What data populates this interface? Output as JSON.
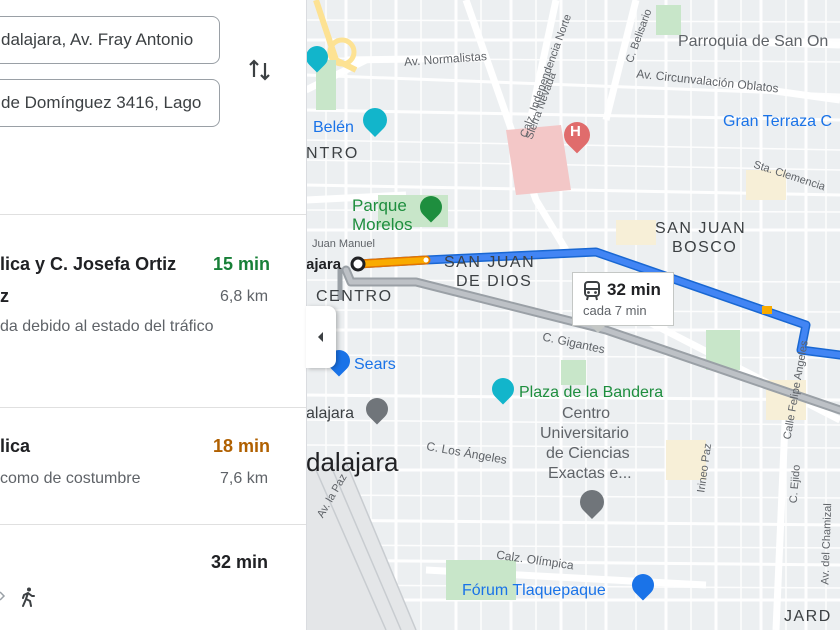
{
  "directions": {
    "origin_value": "dalajara, Av. Fray Antonio",
    "destination_value": "de Domínguez 3416, Lago"
  },
  "routes": [
    {
      "name": "lica y C. Josefa Ortiz",
      "name_line2": "z",
      "time": "15 min",
      "distance": "6,8 km",
      "note": "da debido al estado del tráfico"
    },
    {
      "name": "lica",
      "time": "18 min",
      "distance": "7,6 km",
      "note": "como de costumbre"
    },
    {
      "time": "32 min"
    }
  ],
  "map": {
    "transit_callout": {
      "time": "32 min",
      "frequency": "cada 7 min"
    },
    "labels": {
      "parroquia": "Parroquia de San On",
      "gran_terraza": "Gran Terraza C",
      "belen": "Belén",
      "centro_top": "NTRO",
      "parque": "Parque",
      "morelos": "Morelos",
      "san_juan_bosco_1": "SAN JUAN",
      "san_juan_bosco_2": "BOSCO",
      "san_juan_dios_1": "SAN JUAN",
      "san_juan_dios_2": "DE DIOS",
      "origin_label": "ajara",
      "centro": "CENTRO",
      "juan_manuel": "Juan Manuel",
      "sears": "Sears",
      "plaza_bandera": "Plaza de la Bandera",
      "alajara": "alajara",
      "dalajara_big": "dalajara",
      "cucei_1": "Centro",
      "cucei_2": "Universitario",
      "cucei_3": "de Ciencias",
      "cucei_4": "Exactas e...",
      "forum": "Fórum Tlaquepaque",
      "jard": "JARD",
      "av_normalistas": "Av. Normalistas",
      "av_circunvalacion": "Av. Circunvalación Oblatos",
      "c_gigantes": "C. Gigantes",
      "c_los_angeles": "C. Los Ángeles",
      "calz_olimpica": "Calz. Olímpica",
      "calz_independencia": "Calz. Independencia Norte",
      "sierra_nevada": "Sierra Nevada",
      "c_belisario": "C. Belisario",
      "sta_clemencia": "Sta. Clemencia",
      "c_ejido": "C. Ejido",
      "irineo_paz": "Irineo Paz",
      "av_chamizal": "Av. del Chamizal",
      "calle_felipe": "Calle Felipe Angeles",
      "av_la_paz": "Av. la Paz"
    }
  },
  "colors": {
    "route_primary": "#1a73e8",
    "route_traffic": "#f29900",
    "route_alt": "#9aa0a6",
    "time_fast": "#188038",
    "time_slow": "#b06000",
    "park": "#c8e6c9",
    "poi_green": "#1e8e3e",
    "poi_blue": "#1a73e8",
    "hospital": "#e06c6c"
  },
  "icons": [
    "swap-icon",
    "chevron-left-icon",
    "bus-icon",
    "walk-icon",
    "hospital-icon",
    "museum-icon",
    "park-icon",
    "shopping-bag-icon",
    "location-pin-icon",
    "graduation-icon"
  ]
}
